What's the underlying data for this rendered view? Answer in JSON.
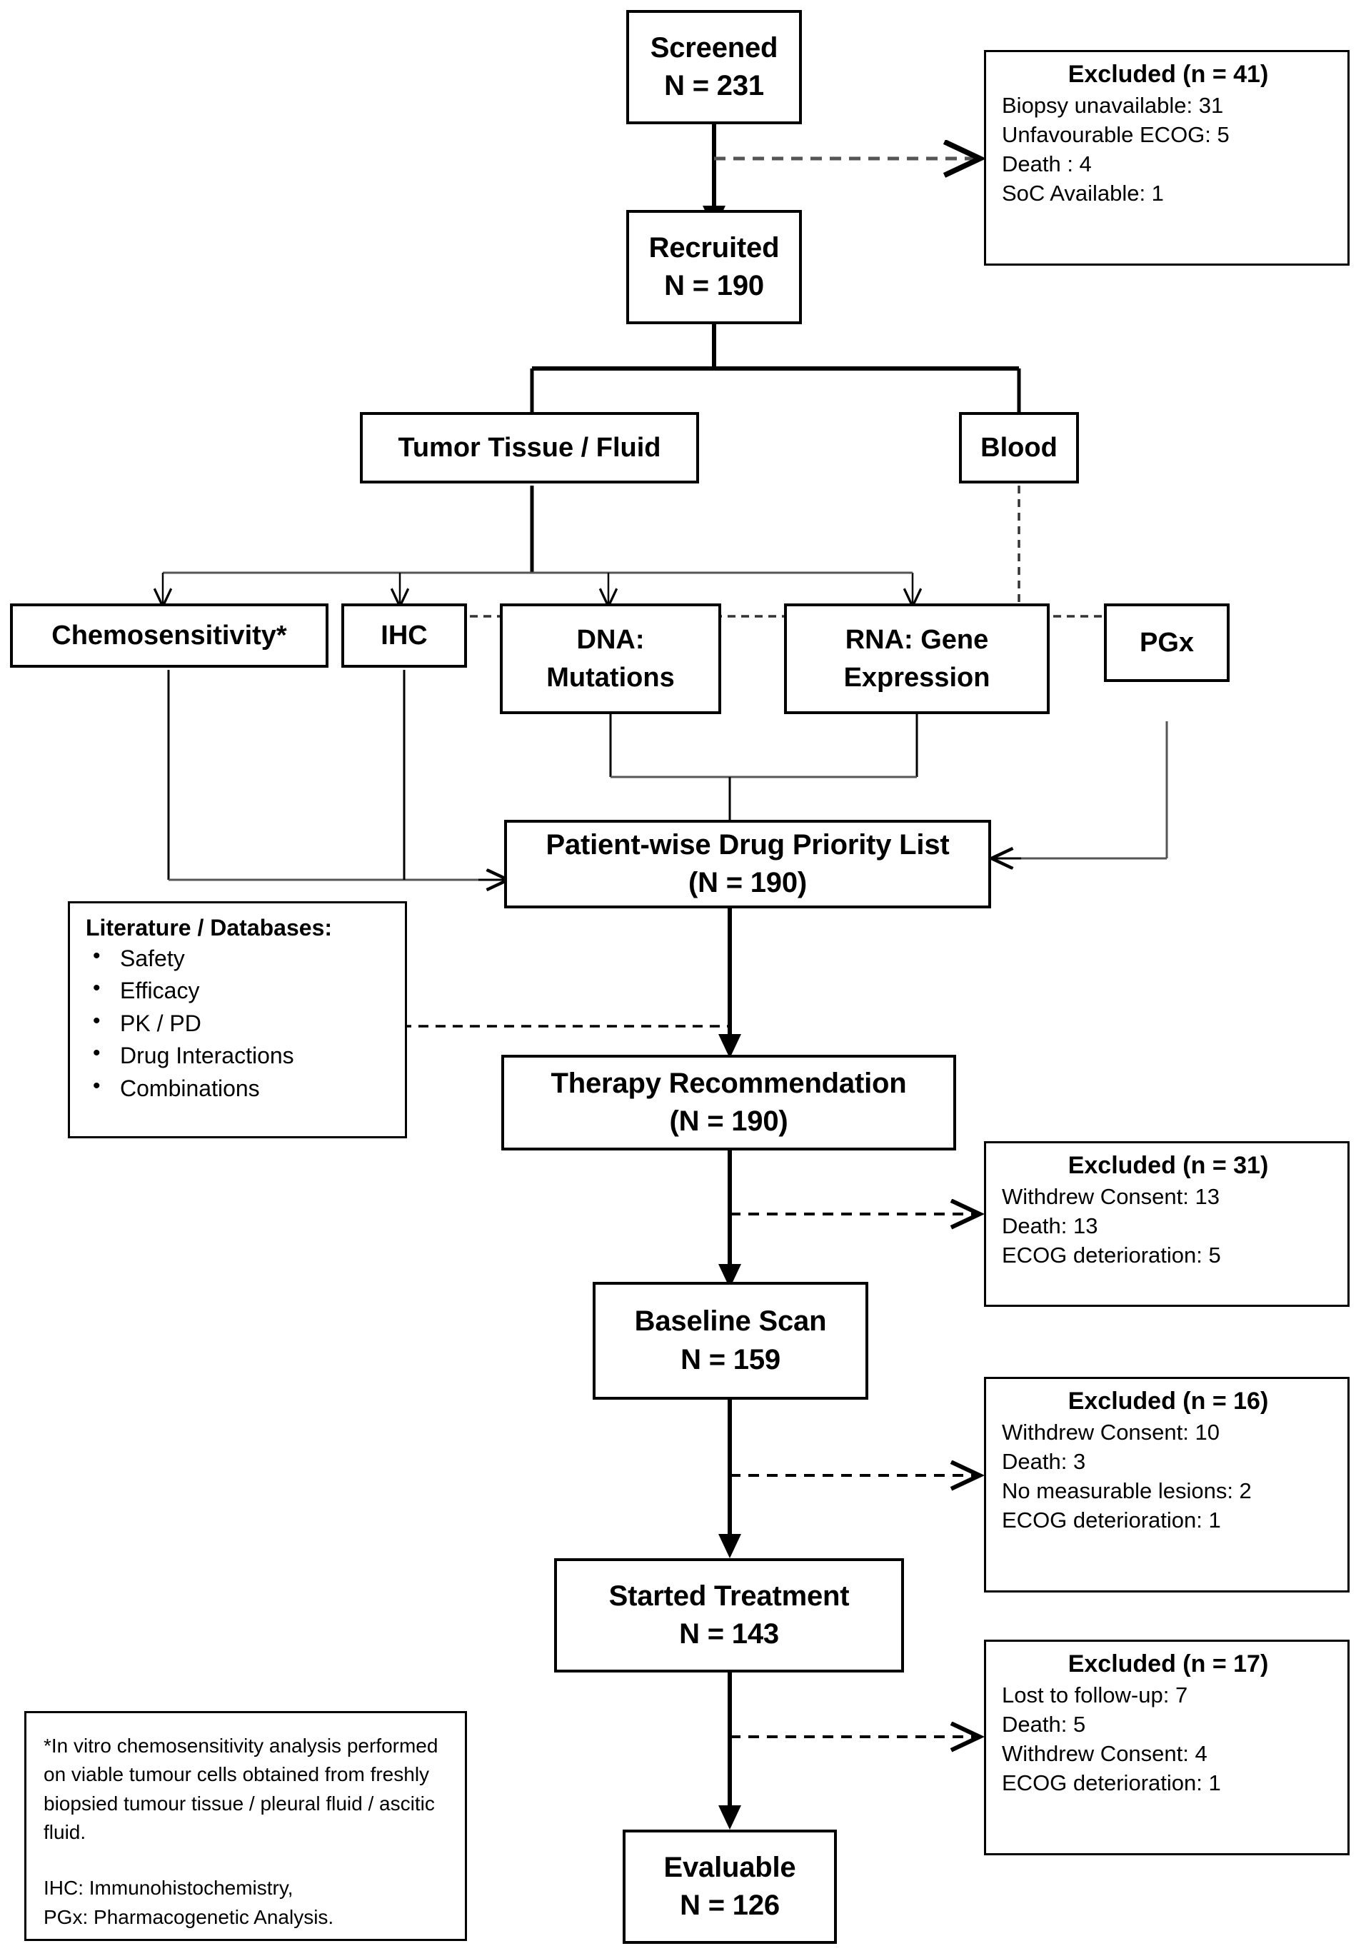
{
  "nodes": {
    "screened": {
      "line1": "Screened",
      "line2": "N = 231"
    },
    "recruited": {
      "line1": "Recruited",
      "line2": "N = 190"
    },
    "tumor": {
      "line1": "Tumor Tissue / Fluid"
    },
    "blood": {
      "line1": "Blood"
    },
    "chemo": {
      "line1": "Chemosensitivity*"
    },
    "ihc": {
      "line1": "IHC"
    },
    "dna": {
      "line1": "DNA:",
      "line2": "Mutations"
    },
    "rna": {
      "line1": "RNA: Gene",
      "line2": "Expression"
    },
    "pgx": {
      "line1": "PGx"
    },
    "dpl": {
      "line1": "Patient-wise Drug Priority List",
      "line2": "(N = 190)"
    },
    "therapy": {
      "line1": "Therapy Recommendation",
      "line2": "(N = 190)"
    },
    "baseline": {
      "line1": "Baseline Scan",
      "line2": "N = 159"
    },
    "started": {
      "line1": "Started  Treatment",
      "line2": "N = 143"
    },
    "evaluable": {
      "line1": "Evaluable",
      "line2": "N = 126"
    }
  },
  "excluded_screened": {
    "head": "Excluded (n = 41)",
    "rows": [
      "Biopsy unavailable: 31",
      "Unfavourable ECOG: 5",
      "Death : 4",
      "SoC Available: 1"
    ]
  },
  "excluded_therapy": {
    "head": "Excluded (n = 31)",
    "rows": [
      "Withdrew Consent: 13",
      "Death: 13",
      "ECOG deterioration: 5"
    ]
  },
  "excluded_baseline": {
    "head": "Excluded (n = 16)",
    "rows": [
      "Withdrew Consent: 10",
      "Death: 3",
      "No measurable lesions: 2",
      "ECOG deterioration: 1"
    ]
  },
  "excluded_started": {
    "head": "Excluded (n = 17)",
    "rows": [
      "Lost to follow-up: 7",
      "Death: 5",
      "Withdrew Consent: 4",
      "ECOG deterioration: 1"
    ]
  },
  "literature": {
    "head": "Literature / Databases:",
    "items": [
      "Safety",
      "Efficacy",
      "PK / PD",
      "Drug Interactions",
      "Combinations"
    ]
  },
  "footnote": {
    "para1": "*In vitro chemosensitivity analysis performed on viable tumour cells obtained from freshly biopsied tumour tissue / pleural fluid / ascitic fluid.",
    "para2": "IHC: Immunohistochemistry,",
    "para3": "PGx: Pharmacogenetic Analysis."
  },
  "colors": {
    "line": "#000000",
    "thin_line": "#404040",
    "background": "#ffffff"
  }
}
